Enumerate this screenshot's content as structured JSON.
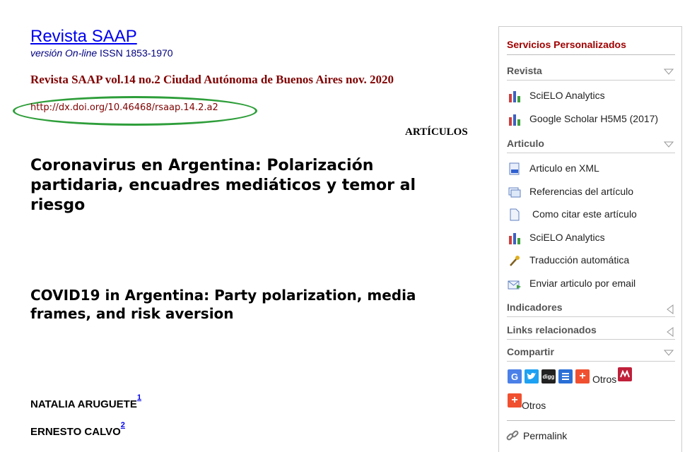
{
  "journal": {
    "title": "Revista SAAP",
    "version_italic": "versión On-line",
    "issn": " ISSN 1853-1970",
    "issue_line": "Revista SAAP vol.14 no.2 Ciudad Autónoma de Buenos Aires nov. 2020",
    "doi": "http://dx.doi.org/10.46468/rsaap.14.2.a2"
  },
  "article": {
    "section": "ARTÍCULOS",
    "title_es": "Coronavirus en Argentina: Polarización partidaria, encuadres mediáticos y temor al riesgo",
    "title_en": "COVID19 in Argentina: Party polarization, media frames, and risk aversion",
    "authors": [
      {
        "name": "NATALIA ARUGUETE",
        "ref": "1"
      },
      {
        "name": "ERNESTO CALVO",
        "ref": "2"
      }
    ]
  },
  "sidebar": {
    "heading": "Servicios Personalizados",
    "revista": {
      "label": "Revista",
      "items": [
        "SciELO Analytics",
        "Google Scholar H5M5 (2017)"
      ]
    },
    "articulo": {
      "label": "Articulo",
      "items": [
        "Articulo en XML",
        "Referencias del artículo",
        "Como citar este artículo",
        "SciELO Analytics",
        "Traducción automática",
        "Enviar articulo por email"
      ]
    },
    "indicadores": "Indicadores",
    "links": "Links relacionados",
    "compartir": {
      "label": "Compartir",
      "otros_1": "Otros",
      "otros_2": "Otros"
    },
    "permalink": "Permalink"
  },
  "colors": {
    "link": "#0000ee",
    "issue": "#800000",
    "highlight_ellipse": "#2e9e3a",
    "sidebar_heading": "#a00000"
  }
}
